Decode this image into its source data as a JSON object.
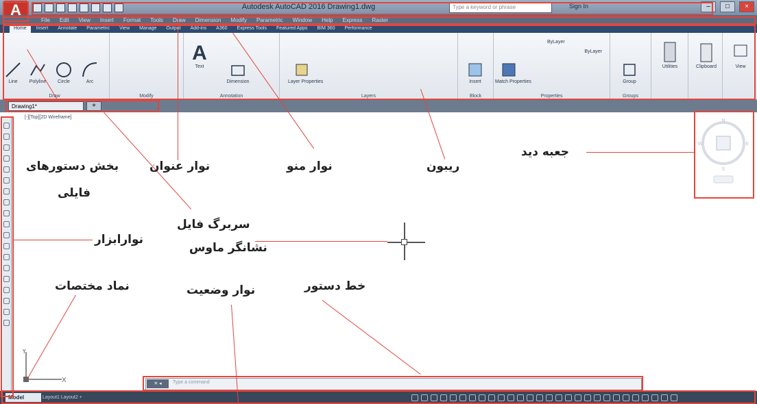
{
  "app": {
    "title": "Autodesk AutoCAD 2016   Drawing1.dwg",
    "search_placeholder": "Type a keyword or phrase",
    "sign_in": "Sign In",
    "logo_letter": "A"
  },
  "menu": [
    "File",
    "Edit",
    "View",
    "Insert",
    "Format",
    "Tools",
    "Draw",
    "Dimension",
    "Modify",
    "Parametric",
    "Window",
    "Help",
    "Express",
    "Raster"
  ],
  "ribbon_tabs": [
    "Home",
    "Insert",
    "Annotate",
    "Parametric",
    "View",
    "Manage",
    "Output",
    "Add-ins",
    "A360",
    "Express Tools",
    "Featured Apps",
    "BIM 360",
    "Performance"
  ],
  "ribbon_panels": {
    "draw": {
      "title": "Draw",
      "tools": [
        "Line",
        "Polyline",
        "Circle",
        "Arc"
      ]
    },
    "modify": {
      "title": "Modify"
    },
    "annotation": {
      "title": "Annotation",
      "tools": [
        "Text",
        "Dimension"
      ]
    },
    "layers": {
      "title": "Layers",
      "tools": [
        "Layer Properties"
      ]
    },
    "block": {
      "title": "Block",
      "tools": [
        "Insert"
      ]
    },
    "properties": {
      "title": "Properties",
      "tools": [
        "Match Properties"
      ],
      "bylayer": "ByLayer",
      "bylayer_line": "ByLayer"
    },
    "groups": {
      "title": "Groups",
      "tools": [
        "Group"
      ]
    },
    "utilities": {
      "title": "Utilities"
    },
    "clipboard": {
      "title": "Clipboard"
    },
    "view": {
      "title": "View"
    }
  },
  "file_tab": {
    "label": "Drawing1*",
    "new_tab": "+"
  },
  "viewport_label": "[-][Top][2D Wireframe]",
  "command_line": {
    "placeholder": "Type a command",
    "buttons": "✕ ◂"
  },
  "status": {
    "model_tab": "Model",
    "layout_tabs": "Layout1  Layout2  +"
  },
  "callouts": {
    "file_commands": "بخش دستورهای",
    "file_commands_2": "فایلی",
    "title_bar": "نوار عنوان",
    "menu_bar": "نوار منو",
    "ribbon": "ریبون",
    "view_cube": "جعبه دید",
    "file_tab": "سربرگ فایل",
    "toolbar": "نوارابزار",
    "cursor": "نشانگر ماوس",
    "ucs": "نماد مختصات",
    "status_bar": "نوار وضعیت",
    "command_line": "خط دستور"
  },
  "colors": {
    "callout_red": "#e2463c",
    "ribbon_blue": "#2e4a70",
    "autocad_red": "#c8342b"
  }
}
